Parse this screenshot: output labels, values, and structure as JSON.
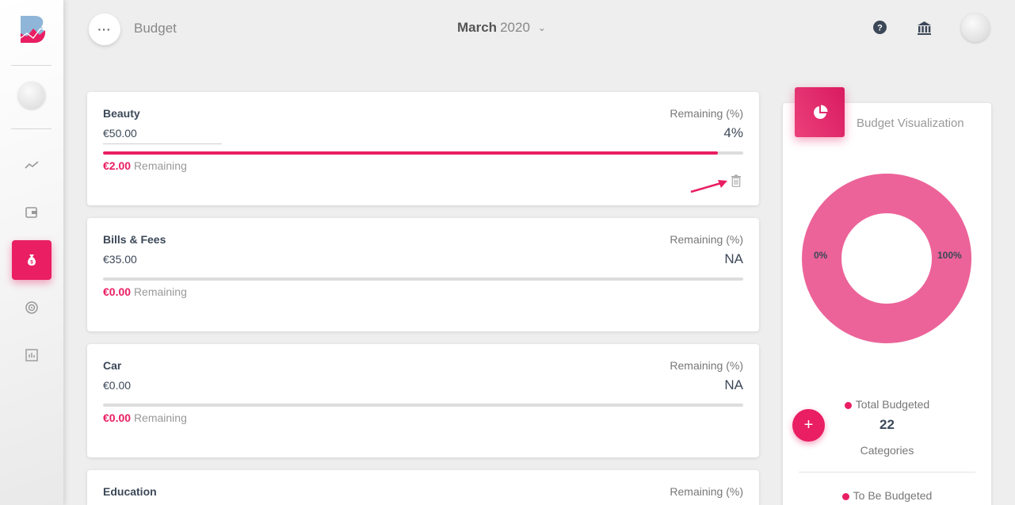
{
  "app": {
    "title": "Budget"
  },
  "header": {
    "month": "March",
    "year": "2020"
  },
  "sidebar": {
    "items": [
      "trend",
      "wallet",
      "budget",
      "goals",
      "reports"
    ]
  },
  "budgets": [
    {
      "name": "Beauty",
      "amount": "€50.00",
      "remaining_label": "Remaining (%)",
      "percent_text": "4%",
      "remaining_amount": "€2.00",
      "remaining_suffix": "Remaining",
      "spent_fraction": 0.96
    },
    {
      "name": "Bills & Fees",
      "amount": "€35.00",
      "remaining_label": "Remaining (%)",
      "percent_text": "NA",
      "remaining_amount": "€0.00",
      "remaining_suffix": "Remaining",
      "spent_fraction": 0
    },
    {
      "name": "Car",
      "amount": "€0.00",
      "remaining_label": "Remaining (%)",
      "percent_text": "NA",
      "remaining_amount": "€0.00",
      "remaining_suffix": "Remaining",
      "spent_fraction": 0
    },
    {
      "name": "Education",
      "remaining_label": "Remaining (%)"
    }
  ],
  "visualization": {
    "title": "Budget Visualization",
    "label_left": "0%",
    "label_right": "100%",
    "total_label": "Total Budgeted",
    "total_value": "22",
    "total_sub": "Categories",
    "to_be_label": "To Be Budgeted",
    "donut_color": "#ec6399"
  },
  "colors": {
    "accent": "#e91e63"
  }
}
